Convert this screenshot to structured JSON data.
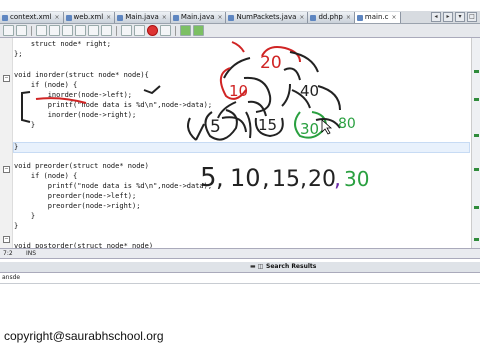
{
  "tabs": [
    {
      "label": "context.xml",
      "active": false
    },
    {
      "label": "web.xml",
      "active": false
    },
    {
      "label": "Main.java",
      "active": false
    },
    {
      "label": "Main.java",
      "active": false
    },
    {
      "label": "NumPackets.java",
      "active": false
    },
    {
      "label": "dd.php",
      "active": false
    },
    {
      "label": "main.c",
      "active": true
    }
  ],
  "code": {
    "lines": [
      "    struct node* right;",
      "};",
      "",
      "void inorder(struct node* node){",
      "    if (node) {",
      "        inorder(node->left);",
      "        printf(\"node data is %d\\n\",node->data);",
      "        inorder(node->right);",
      "    }",
      "",
      "}",
      "",
      "void preorder(struct node* node)",
      "    if (node) {",
      "        printf(\"node data is %d\\n\",node->data);",
      "        preorder(node->left);",
      "        preorder(node->right);",
      "    }",
      "}",
      "",
      "void postorder(struct node* node)"
    ]
  },
  "status": {
    "position": "7:2",
    "mode": "INS"
  },
  "search_results": {
    "label": "Search Results"
  },
  "output": {
    "tab": "ansde"
  },
  "annotations": {
    "tree_nodes": [
      "20",
      "10",
      "40",
      "5",
      "15",
      "30",
      "80"
    ],
    "sequence_digits": [
      "5",
      "10",
      "15",
      "20",
      "30"
    ]
  },
  "copyright": "copyright@saurabhschool.org"
}
